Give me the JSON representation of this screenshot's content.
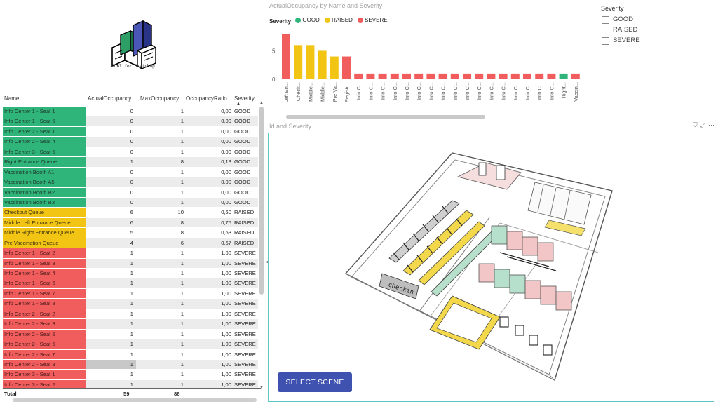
{
  "logo": {
    "caption": "3DBI for SketchUp"
  },
  "table": {
    "headers": [
      "Name",
      "ActualOccupancy",
      "MaxOccupancy",
      "OccupancyRatio",
      "Severity"
    ],
    "rows": [
      {
        "name": "Info Center 1 - Seat 1",
        "actual": "0",
        "max": "1",
        "ratio": "0,00",
        "severity": "GOOD"
      },
      {
        "name": "Info Center 1 - Seat 5",
        "actual": "0",
        "max": "1",
        "ratio": "0,00",
        "severity": "GOOD"
      },
      {
        "name": "Info Center 2 - Seat 1",
        "actual": "0",
        "max": "1",
        "ratio": "0,00",
        "severity": "GOOD"
      },
      {
        "name": "Info Center 2 - Seat 4",
        "actual": "0",
        "max": "1",
        "ratio": "0,00",
        "severity": "GOOD"
      },
      {
        "name": "Info Center 3 - Seat 6",
        "actual": "0",
        "max": "1",
        "ratio": "0,00",
        "severity": "GOOD"
      },
      {
        "name": "Right Entrance Queue",
        "actual": "1",
        "max": "8",
        "ratio": "0,13",
        "severity": "GOOD"
      },
      {
        "name": "Vaccination Booth A1",
        "actual": "0",
        "max": "1",
        "ratio": "0,00",
        "severity": "GOOD"
      },
      {
        "name": "Vaccination Booth A5",
        "actual": "0",
        "max": "1",
        "ratio": "0,00",
        "severity": "GOOD"
      },
      {
        "name": "Vaccination Booth B2",
        "actual": "0",
        "max": "1",
        "ratio": "0,00",
        "severity": "GOOD"
      },
      {
        "name": "Vaccination Booth B3",
        "actual": "0",
        "max": "1",
        "ratio": "0,00",
        "severity": "GOOD"
      },
      {
        "name": "Checkout Queue",
        "actual": "6",
        "max": "10",
        "ratio": "0,60",
        "severity": "RAISED"
      },
      {
        "name": "Middle Left Entrance Queue",
        "actual": "6",
        "max": "8",
        "ratio": "0,75",
        "severity": "RAISED"
      },
      {
        "name": "Middle Right Entrance Queue",
        "actual": "5",
        "max": "8",
        "ratio": "0,63",
        "severity": "RAISED"
      },
      {
        "name": "Pre Vaccination Queue",
        "actual": "4",
        "max": "6",
        "ratio": "0,67",
        "severity": "RAISED"
      },
      {
        "name": "Info Center 1 - Seat 2",
        "actual": "1",
        "max": "1",
        "ratio": "1,00",
        "severity": "SEVERE"
      },
      {
        "name": "Info Center 1 - Seat 3",
        "actual": "1",
        "max": "1",
        "ratio": "1,00",
        "severity": "SEVERE"
      },
      {
        "name": "Info Center 1 - Seat 4",
        "actual": "1",
        "max": "1",
        "ratio": "1,00",
        "severity": "SEVERE"
      },
      {
        "name": "Info Center 1 - Seat 6",
        "actual": "1",
        "max": "1",
        "ratio": "1,00",
        "severity": "SEVERE"
      },
      {
        "name": "Info Center 1 - Seat 7",
        "actual": "1",
        "max": "1",
        "ratio": "1,00",
        "severity": "SEVERE"
      },
      {
        "name": "Info Center 1 - Seat 8",
        "actual": "1",
        "max": "1",
        "ratio": "1,00",
        "severity": "SEVERE"
      },
      {
        "name": "Info Center 2 - Seat 2",
        "actual": "1",
        "max": "1",
        "ratio": "1,00",
        "severity": "SEVERE"
      },
      {
        "name": "Info Center 2 - Seat 3",
        "actual": "1",
        "max": "1",
        "ratio": "1,00",
        "severity": "SEVERE"
      },
      {
        "name": "Info Center 2 - Seat 5",
        "actual": "1",
        "max": "1",
        "ratio": "1,00",
        "severity": "SEVERE"
      },
      {
        "name": "Info Center 2 - Seat 6",
        "actual": "1",
        "max": "1",
        "ratio": "1,00",
        "severity": "SEVERE"
      },
      {
        "name": "Info Center 2 - Seat 7",
        "actual": "1",
        "max": "1",
        "ratio": "1,00",
        "severity": "SEVERE"
      },
      {
        "name": "Info Center 2 - Seat 8",
        "actual": "1",
        "max": "1",
        "ratio": "1,00",
        "severity": "SEVERE",
        "highlight": true
      },
      {
        "name": "Info Center 3 - Seat 1",
        "actual": "1",
        "max": "1",
        "ratio": "1,00",
        "severity": "SEVERE"
      },
      {
        "name": "Info Center 3 - Seat 2",
        "actual": "1",
        "max": "1",
        "ratio": "1,00",
        "severity": "SEVERE"
      }
    ],
    "total": {
      "label": "Total",
      "actual": "59",
      "max": "86"
    }
  },
  "chart": {
    "title": "ActualOccupancy by Name and Severity",
    "legend_label": "Severity",
    "legend": [
      {
        "name": "GOOD",
        "color": "#2fb57a"
      },
      {
        "name": "RAISED",
        "color": "#f2c515"
      },
      {
        "name": "SEVERE",
        "color": "#f15d5d"
      }
    ]
  },
  "chart_data": {
    "type": "bar",
    "title": "ActualOccupancy by Name and Severity",
    "categories": [
      "Left En...",
      "Check...",
      "Middle...",
      "Middle...",
      "Pre Va...",
      "Registr...",
      "Info C...",
      "Info C...",
      "Info C...",
      "Info C...",
      "Info C...",
      "Info C...",
      "Info C...",
      "Info C...",
      "Info C...",
      "Info C...",
      "Info C...",
      "Info C...",
      "Info C...",
      "Info C...",
      "Info C...",
      "Info C...",
      "Info C...",
      "Right...",
      "Vaccin..."
    ],
    "values": [
      8,
      6,
      6,
      5,
      4,
      4,
      1,
      1,
      1,
      1,
      1,
      1,
      1,
      1,
      1,
      1,
      1,
      1,
      1,
      1,
      1,
      1,
      1,
      1,
      1
    ],
    "severity": [
      "SEVERE",
      "RAISED",
      "RAISED",
      "RAISED",
      "RAISED",
      "SEVERE",
      "SEVERE",
      "SEVERE",
      "SEVERE",
      "SEVERE",
      "SEVERE",
      "SEVERE",
      "SEVERE",
      "SEVERE",
      "SEVERE",
      "SEVERE",
      "SEVERE",
      "SEVERE",
      "SEVERE",
      "SEVERE",
      "SEVERE",
      "SEVERE",
      "SEVERE",
      "GOOD",
      "SEVERE"
    ],
    "yticks": [
      "0",
      "5"
    ],
    "ylim": [
      0,
      9
    ],
    "grid": false,
    "legend_position": "top-left"
  },
  "slicer": {
    "title": "Severity",
    "options": [
      "GOOD",
      "RAISED",
      "SEVERE"
    ]
  },
  "model": {
    "title": "Id and Severity",
    "button_label": "SELECT SCENE",
    "icons": [
      "filter-icon",
      "expand-icon",
      "more-options-icon"
    ]
  },
  "colors": {
    "good": "#2fb57a",
    "raised": "#f2c515",
    "severe": "#f15d5d",
    "button": "#3f52b0",
    "frame": "#60c6c3"
  }
}
